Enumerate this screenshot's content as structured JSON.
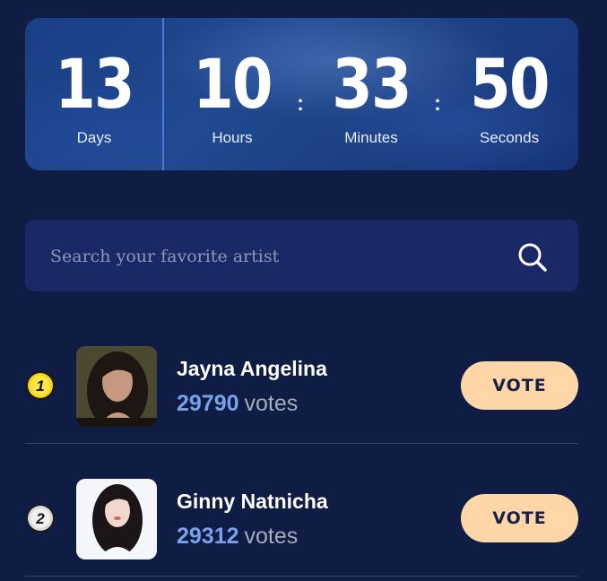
{
  "countdown": {
    "days": {
      "value": "13",
      "label": "Days"
    },
    "hours": {
      "value": "10",
      "label": "Hours"
    },
    "minutes": {
      "value": "33",
      "label": "Minutes"
    },
    "seconds": {
      "value": "50",
      "label": "Seconds"
    },
    "separator": ":"
  },
  "search": {
    "placeholder": "Search your favorite artist",
    "value": "",
    "icon": "search-icon"
  },
  "artists": [
    {
      "rank": "1",
      "rank_badge_color": "#f6d21a",
      "name": "Jayna Angelina",
      "votes": "29790",
      "votes_label": "votes",
      "vote_button": "VOTE"
    },
    {
      "rank": "2",
      "rank_badge_color": "#d9d9d9",
      "name": "Ginny Natnicha",
      "votes": "29312",
      "votes_label": "votes",
      "vote_button": "VOTE"
    }
  ],
  "colors": {
    "background": "#0f1c43",
    "accent_votes": "#7aa2ea",
    "vote_button": "#ffd6a8"
  }
}
